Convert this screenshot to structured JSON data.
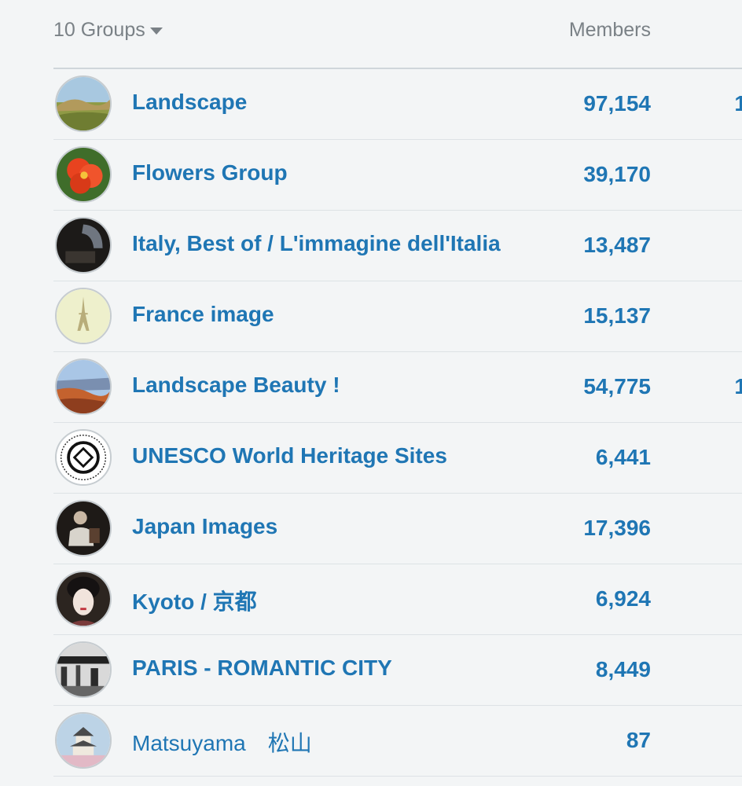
{
  "header": {
    "groups_label": "10 Groups",
    "members_label": "Members"
  },
  "groups": [
    {
      "name": "Landscape",
      "members": "97,154",
      "extra": "1",
      "bold": true,
      "avatar_icon": "landscape-hills-avatar"
    },
    {
      "name": "Flowers Group",
      "members": "39,170",
      "extra": "",
      "bold": true,
      "avatar_icon": "red-flower-avatar"
    },
    {
      "name": "Italy, Best of / L'immagine dell'Italia",
      "members": "13,487",
      "extra": "",
      "bold": true,
      "avatar_icon": "dark-arch-avatar"
    },
    {
      "name": "France image",
      "members": "15,137",
      "extra": "",
      "bold": true,
      "avatar_icon": "eiffel-tower-avatar"
    },
    {
      "name": "Landscape Beauty !",
      "members": "54,775",
      "extra": "1",
      "bold": true,
      "avatar_icon": "canyon-avatar"
    },
    {
      "name": "UNESCO World Heritage Sites",
      "members": "6,441",
      "extra": "",
      "bold": true,
      "avatar_icon": "unesco-emblem-avatar"
    },
    {
      "name": "Japan Images",
      "members": "17,396",
      "extra": "",
      "bold": true,
      "avatar_icon": "person-portrait-avatar"
    },
    {
      "name": "Kyoto / 京都",
      "members": "6,924",
      "extra": "",
      "bold": true,
      "avatar_icon": "geisha-portrait-avatar"
    },
    {
      "name": "PARIS - ROMANTIC CITY",
      "members": "8,449",
      "extra": "",
      "bold": true,
      "avatar_icon": "bw-city-avatar"
    },
    {
      "name": "Matsuyama　松山",
      "members": "87",
      "extra": "",
      "bold": false,
      "avatar_icon": "castle-avatar"
    }
  ]
}
